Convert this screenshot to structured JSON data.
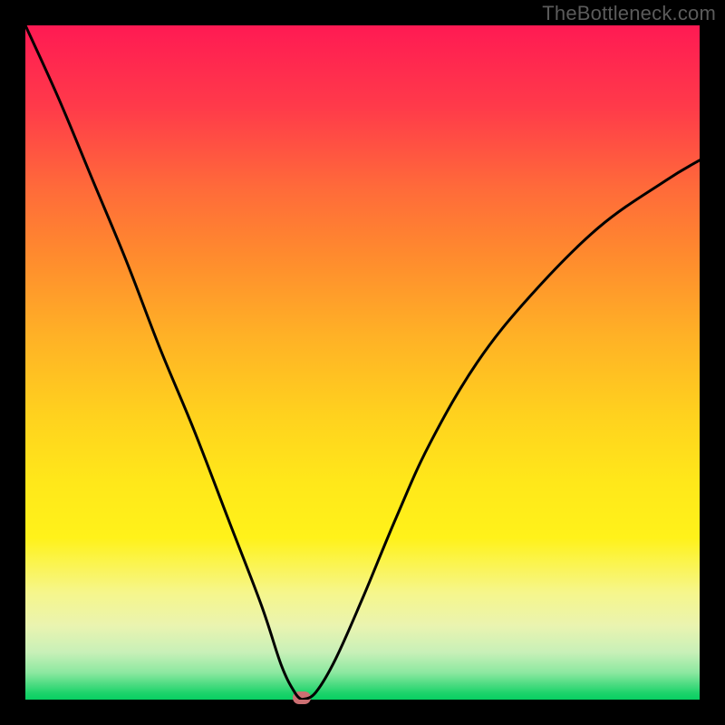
{
  "watermark": "TheBottleneck.com",
  "colors": {
    "curve_stroke": "#000000",
    "marker_fill": "#cc6f72"
  },
  "chart_data": {
    "type": "line",
    "title": "",
    "xlabel": "",
    "ylabel": "",
    "xlim": [
      0,
      100
    ],
    "ylim": [
      0,
      100
    ],
    "grid": false,
    "legend": false,
    "series": [
      {
        "name": "left-branch",
        "x": [
          0,
          5,
          10,
          15,
          20,
          25,
          30,
          35,
          38,
          40,
          41
        ],
        "y": [
          100,
          89,
          77,
          65,
          52,
          40,
          27,
          14,
          5,
          1,
          0
        ]
      },
      {
        "name": "right-branch",
        "x": [
          41,
          43,
          46,
          50,
          55,
          60,
          67,
          75,
          85,
          95,
          100
        ],
        "y": [
          0,
          1,
          6,
          15,
          27,
          38,
          50,
          60,
          70,
          77,
          80
        ]
      }
    ],
    "marker": {
      "x": 41,
      "y": 0
    },
    "background_gradient_meaning": "top=high bottleneck (red), bottom=no bottleneck (green)"
  }
}
